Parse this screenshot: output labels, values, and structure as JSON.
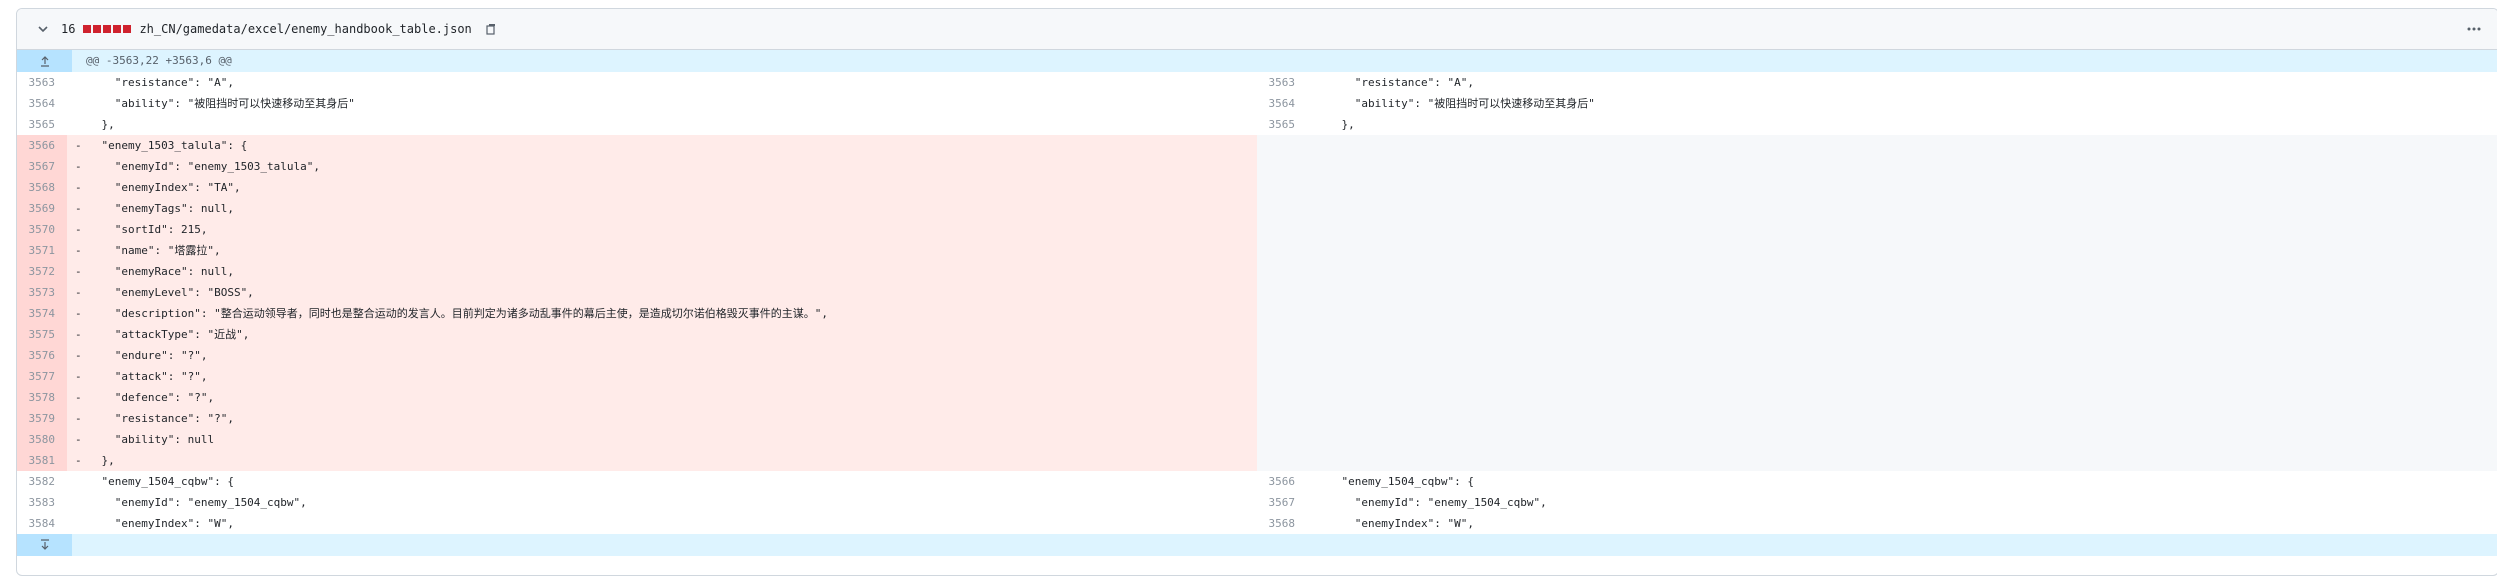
{
  "file": {
    "change_count": "16",
    "path": "zh_CN/gamedata/excel/enemy_handbook_table.json",
    "icons": {
      "collapse": "chevron-down-icon",
      "copy": "copy-icon",
      "menu": "kebab-menu-icon",
      "expand_up": "expand-up-icon",
      "expand_down": "expand-down-icon"
    }
  },
  "hunk": {
    "header": "@@ -3563,22 +3563,6 @@"
  },
  "lines": [
    {
      "type": "ctx",
      "l": "3563",
      "r": "3563",
      "code": "      \"resistance\": \"A\","
    },
    {
      "type": "ctx",
      "l": "3564",
      "r": "3564",
      "code": "      \"ability\": \"被阻挡时可以快速移动至其身后\""
    },
    {
      "type": "ctx",
      "l": "3565",
      "r": "3565",
      "code": "    },"
    },
    {
      "type": "del",
      "l": "3566",
      "code": "-   \"enemy_1503_talula\": {"
    },
    {
      "type": "del",
      "l": "3567",
      "code": "-     \"enemyId\": \"enemy_1503_talula\","
    },
    {
      "type": "del",
      "l": "3568",
      "code": "-     \"enemyIndex\": \"TA\","
    },
    {
      "type": "del",
      "l": "3569",
      "code": "-     \"enemyTags\": null,"
    },
    {
      "type": "del",
      "l": "3570",
      "code": "-     \"sortId\": 215,"
    },
    {
      "type": "del",
      "l": "3571",
      "code": "-     \"name\": \"塔露拉\","
    },
    {
      "type": "del",
      "l": "3572",
      "code": "-     \"enemyRace\": null,"
    },
    {
      "type": "del",
      "l": "3573",
      "code": "-     \"enemyLevel\": \"BOSS\","
    },
    {
      "type": "del",
      "l": "3574",
      "code": "-     \"description\": \"整合运动领导者，同时也是整合运动的发言人。目前判定为诸多动乱事件的幕后主使，是造成切尔诺伯格毁灭事件的主谋。\","
    },
    {
      "type": "del",
      "l": "3575",
      "code": "-     \"attackType\": \"近战\","
    },
    {
      "type": "del",
      "l": "3576",
      "code": "-     \"endure\": \"?\","
    },
    {
      "type": "del",
      "l": "3577",
      "code": "-     \"attack\": \"?\","
    },
    {
      "type": "del",
      "l": "3578",
      "code": "-     \"defence\": \"?\","
    },
    {
      "type": "del",
      "l": "3579",
      "code": "-     \"resistance\": \"?\","
    },
    {
      "type": "del",
      "l": "3580",
      "code": "-     \"ability\": null"
    },
    {
      "type": "del",
      "l": "3581",
      "code": "-   },"
    },
    {
      "type": "ctx",
      "l": "3582",
      "r": "3566",
      "code": "    \"enemy_1504_cqbw\": {"
    },
    {
      "type": "ctx",
      "l": "3583",
      "r": "3567",
      "code": "      \"enemyId\": \"enemy_1504_cqbw\","
    },
    {
      "type": "ctx",
      "l": "3584",
      "r": "3568",
      "code": "      \"enemyIndex\": \"W\","
    }
  ]
}
